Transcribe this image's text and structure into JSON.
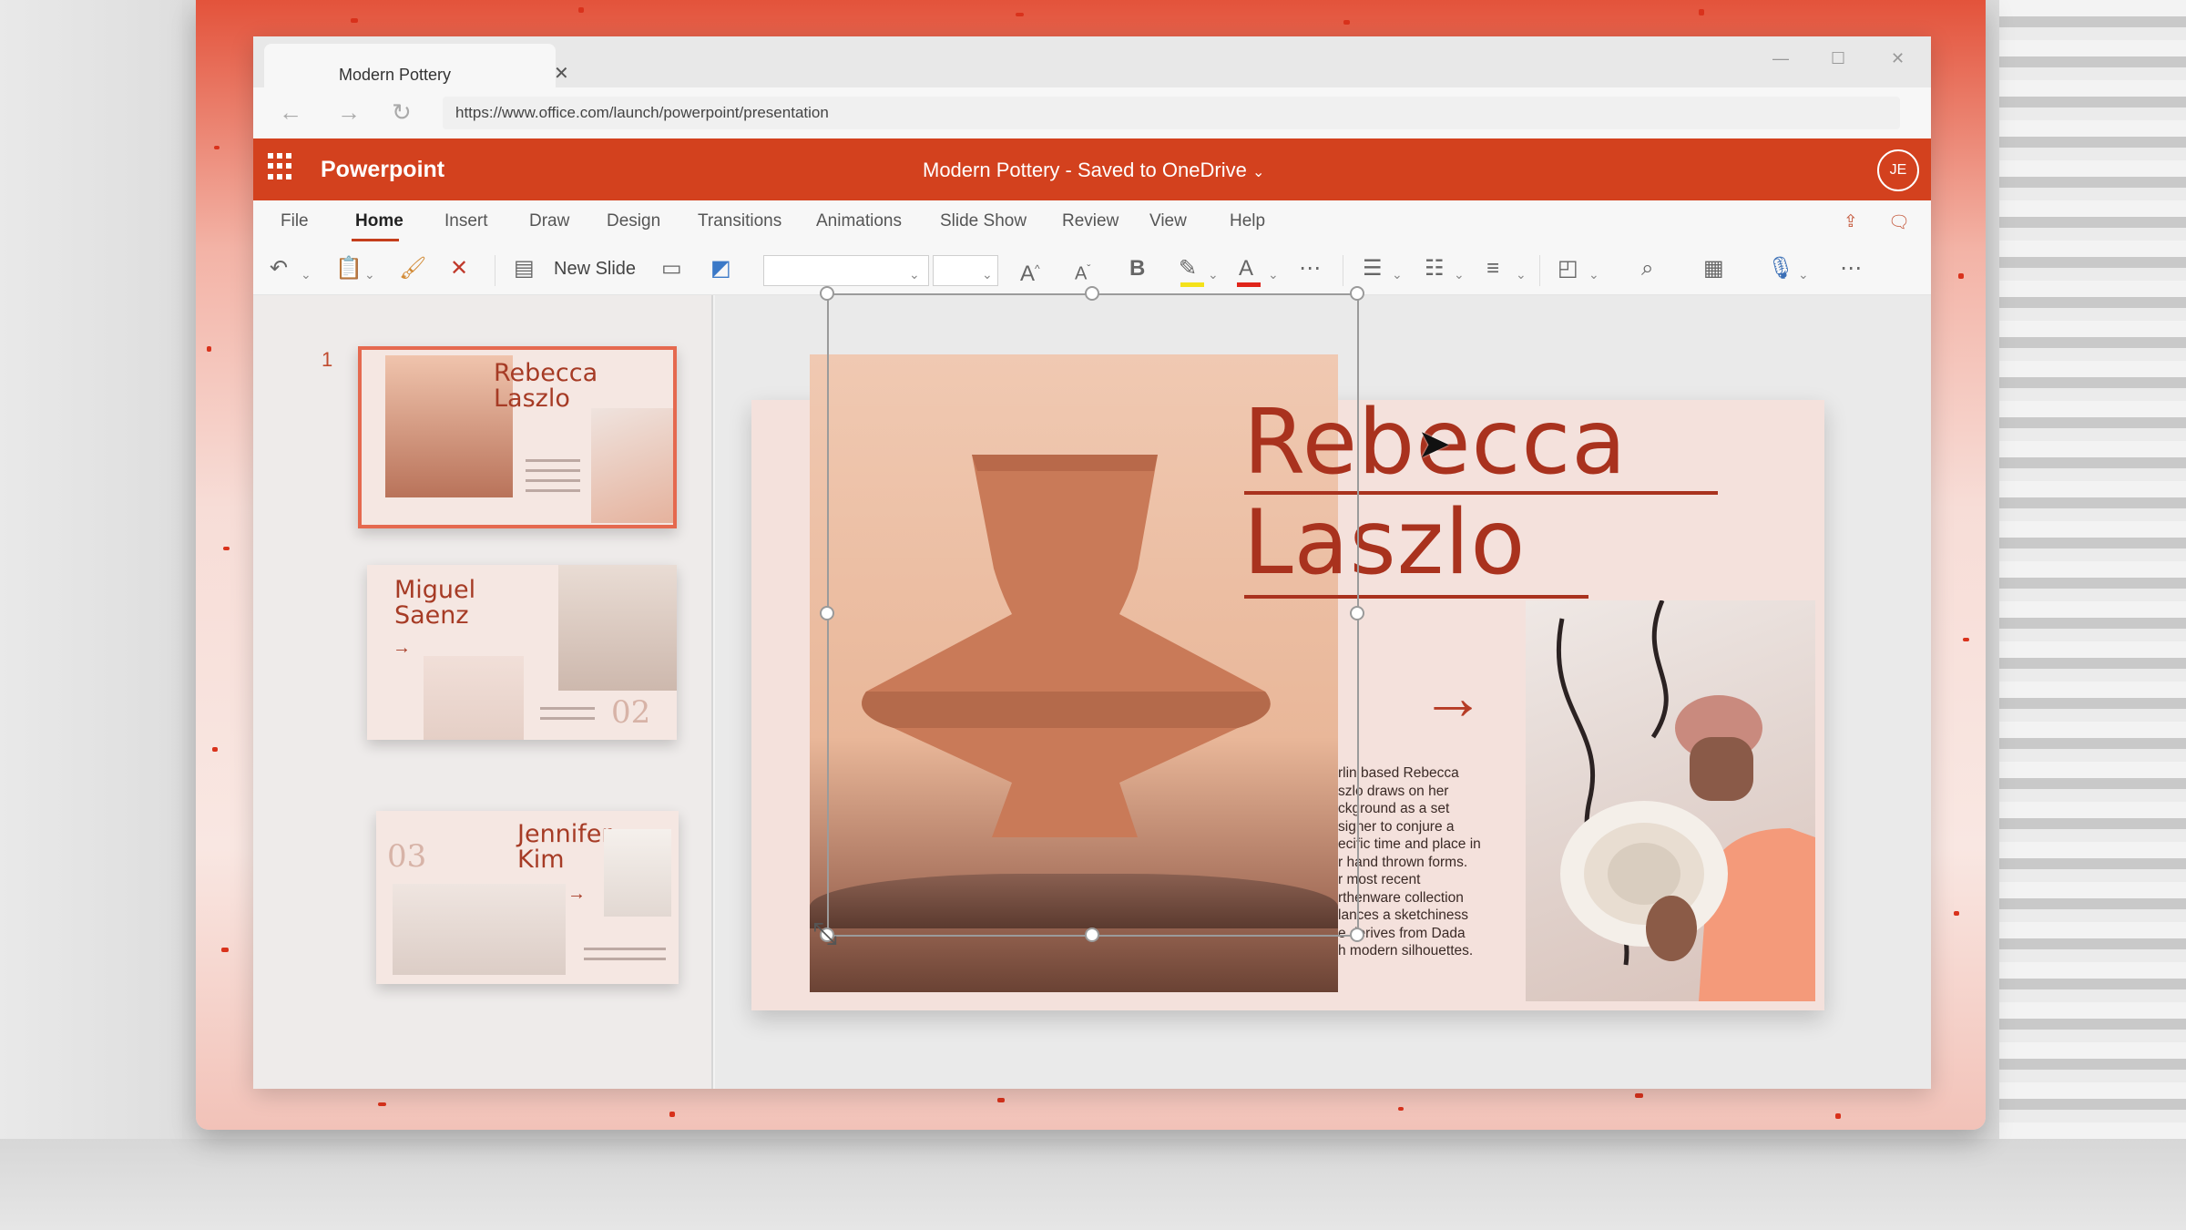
{
  "browser": {
    "tab_title": "Modern Pottery",
    "url": "https://www.office.com/launch/powerpoint/presentation"
  },
  "app": {
    "name": "Powerpoint",
    "document_title": "Modern Pottery - Saved to OneDrive",
    "user_initials": "JE",
    "brand_color": "#d3411e"
  },
  "ribbon": {
    "tabs": [
      "File",
      "Home",
      "Insert",
      "Draw",
      "Design",
      "Transitions",
      "Animations",
      "Slide Show",
      "Review",
      "View",
      "Help"
    ],
    "active_tab": "Home",
    "new_slide_label": "New Slide"
  },
  "thumbnails": [
    {
      "number": "1",
      "title_line1": "Rebecca",
      "title_line2": "Laszlo",
      "selected": true
    },
    {
      "number": "",
      "title_line1": "Miguel",
      "title_line2": "Saenz",
      "badge": "02"
    },
    {
      "number": "",
      "title_line1": "Jennifer",
      "title_line2": "Kim",
      "badge": "03"
    }
  ],
  "slide": {
    "title_line1": "Rebecca",
    "title_line2": "Laszlo",
    "body": "rlin based Rebecca\nszlo draws on her\nckground as a set\nsigner to conjure a\necific time and place in\nr hand thrown forms.\nr most recent\nrthenware collection\nlances a sketchiness\ne derives from Dada\nh modern silhouettes."
  },
  "icons": {
    "arrow": "→",
    "dropdown": "chevron-down-icon"
  }
}
